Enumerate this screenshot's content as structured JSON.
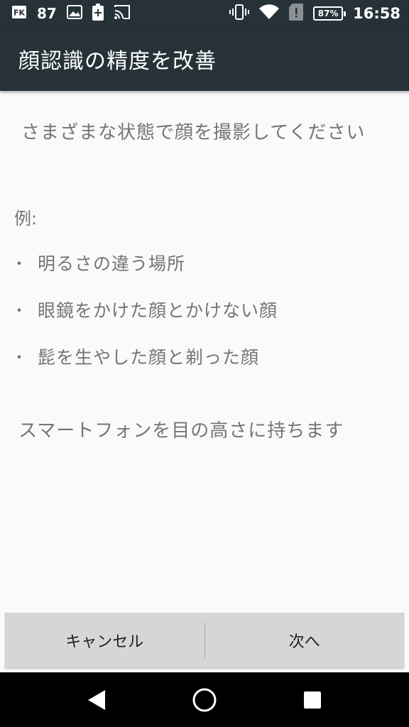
{
  "status_bar": {
    "app_badge": "87",
    "battery": "87%",
    "time": "16:58",
    "icons": [
      "fk-app-icon",
      "image-icon",
      "battery-saver-icon",
      "cast-icon",
      "vibrate-icon",
      "wifi-icon",
      "sim-alert-icon",
      "battery-icon"
    ]
  },
  "app_bar": {
    "title": "顔認識の精度を改善"
  },
  "content": {
    "intro": "さまざまな状態で顔を撮影してください",
    "example_label": "例:",
    "bullet": "・",
    "examples": [
      "明るさの違う場所",
      "眼鏡をかけた顔とかけない顔",
      "髭を生やした顔と剃った顔"
    ],
    "hint": "スマートフォンを目の高さに持ちます"
  },
  "buttons": {
    "cancel": "キャンセル",
    "next": "次へ"
  },
  "nav_bar": {
    "icons": [
      "back-icon",
      "home-icon",
      "recents-icon"
    ]
  },
  "colors": {
    "app_bar": "#263238",
    "background": "#fafafa",
    "text": "#757575",
    "button_bar": "#d6d6d6"
  }
}
